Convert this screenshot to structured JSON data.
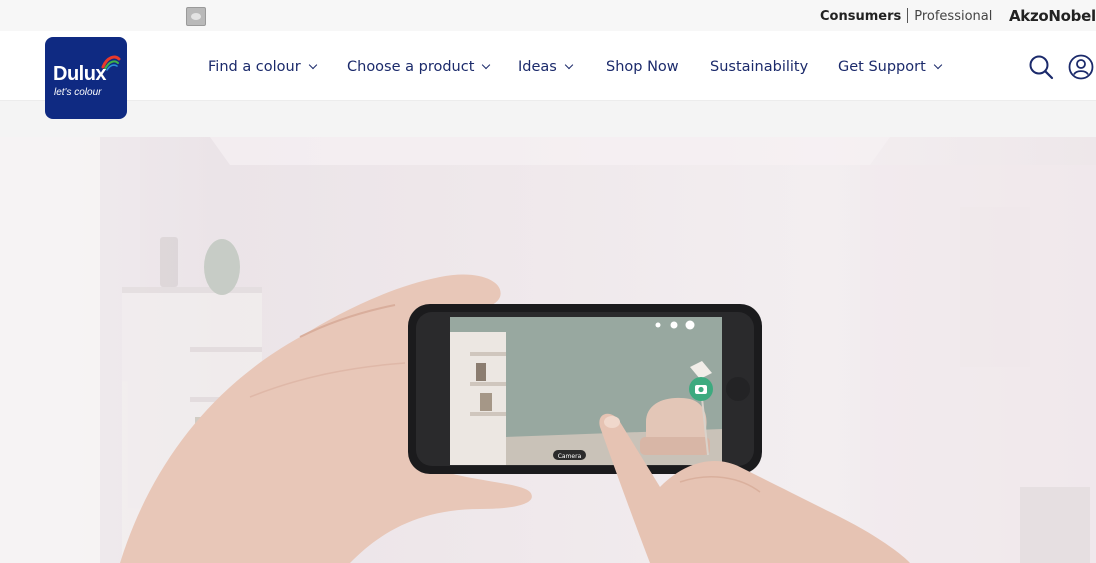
{
  "topbar": {
    "consumers": "Consumers",
    "professional": "Professional",
    "corporate": "AkzoNobel"
  },
  "logo": {
    "brand": "Dulux",
    "tagline": "let's colour",
    "color": "#0f2a82"
  },
  "nav": {
    "items": [
      {
        "label": "Find a colour",
        "dropdown": true
      },
      {
        "label": "Choose a product",
        "dropdown": true
      },
      {
        "label": "Ideas",
        "dropdown": true
      },
      {
        "label": "Shop Now",
        "dropdown": false
      },
      {
        "label": "Sustainability",
        "dropdown": false
      },
      {
        "label": "Get Support",
        "dropdown": true
      }
    ]
  },
  "icons": {
    "search": "search-icon",
    "account": "user-icon"
  },
  "hero": {
    "phone_camera_label": "Camera",
    "wall_color": "#9aaaa2",
    "accent_color": "#3daa7f"
  },
  "colors": {
    "nav_text": "#1b2a6b",
    "brand": "#0f2a82"
  }
}
